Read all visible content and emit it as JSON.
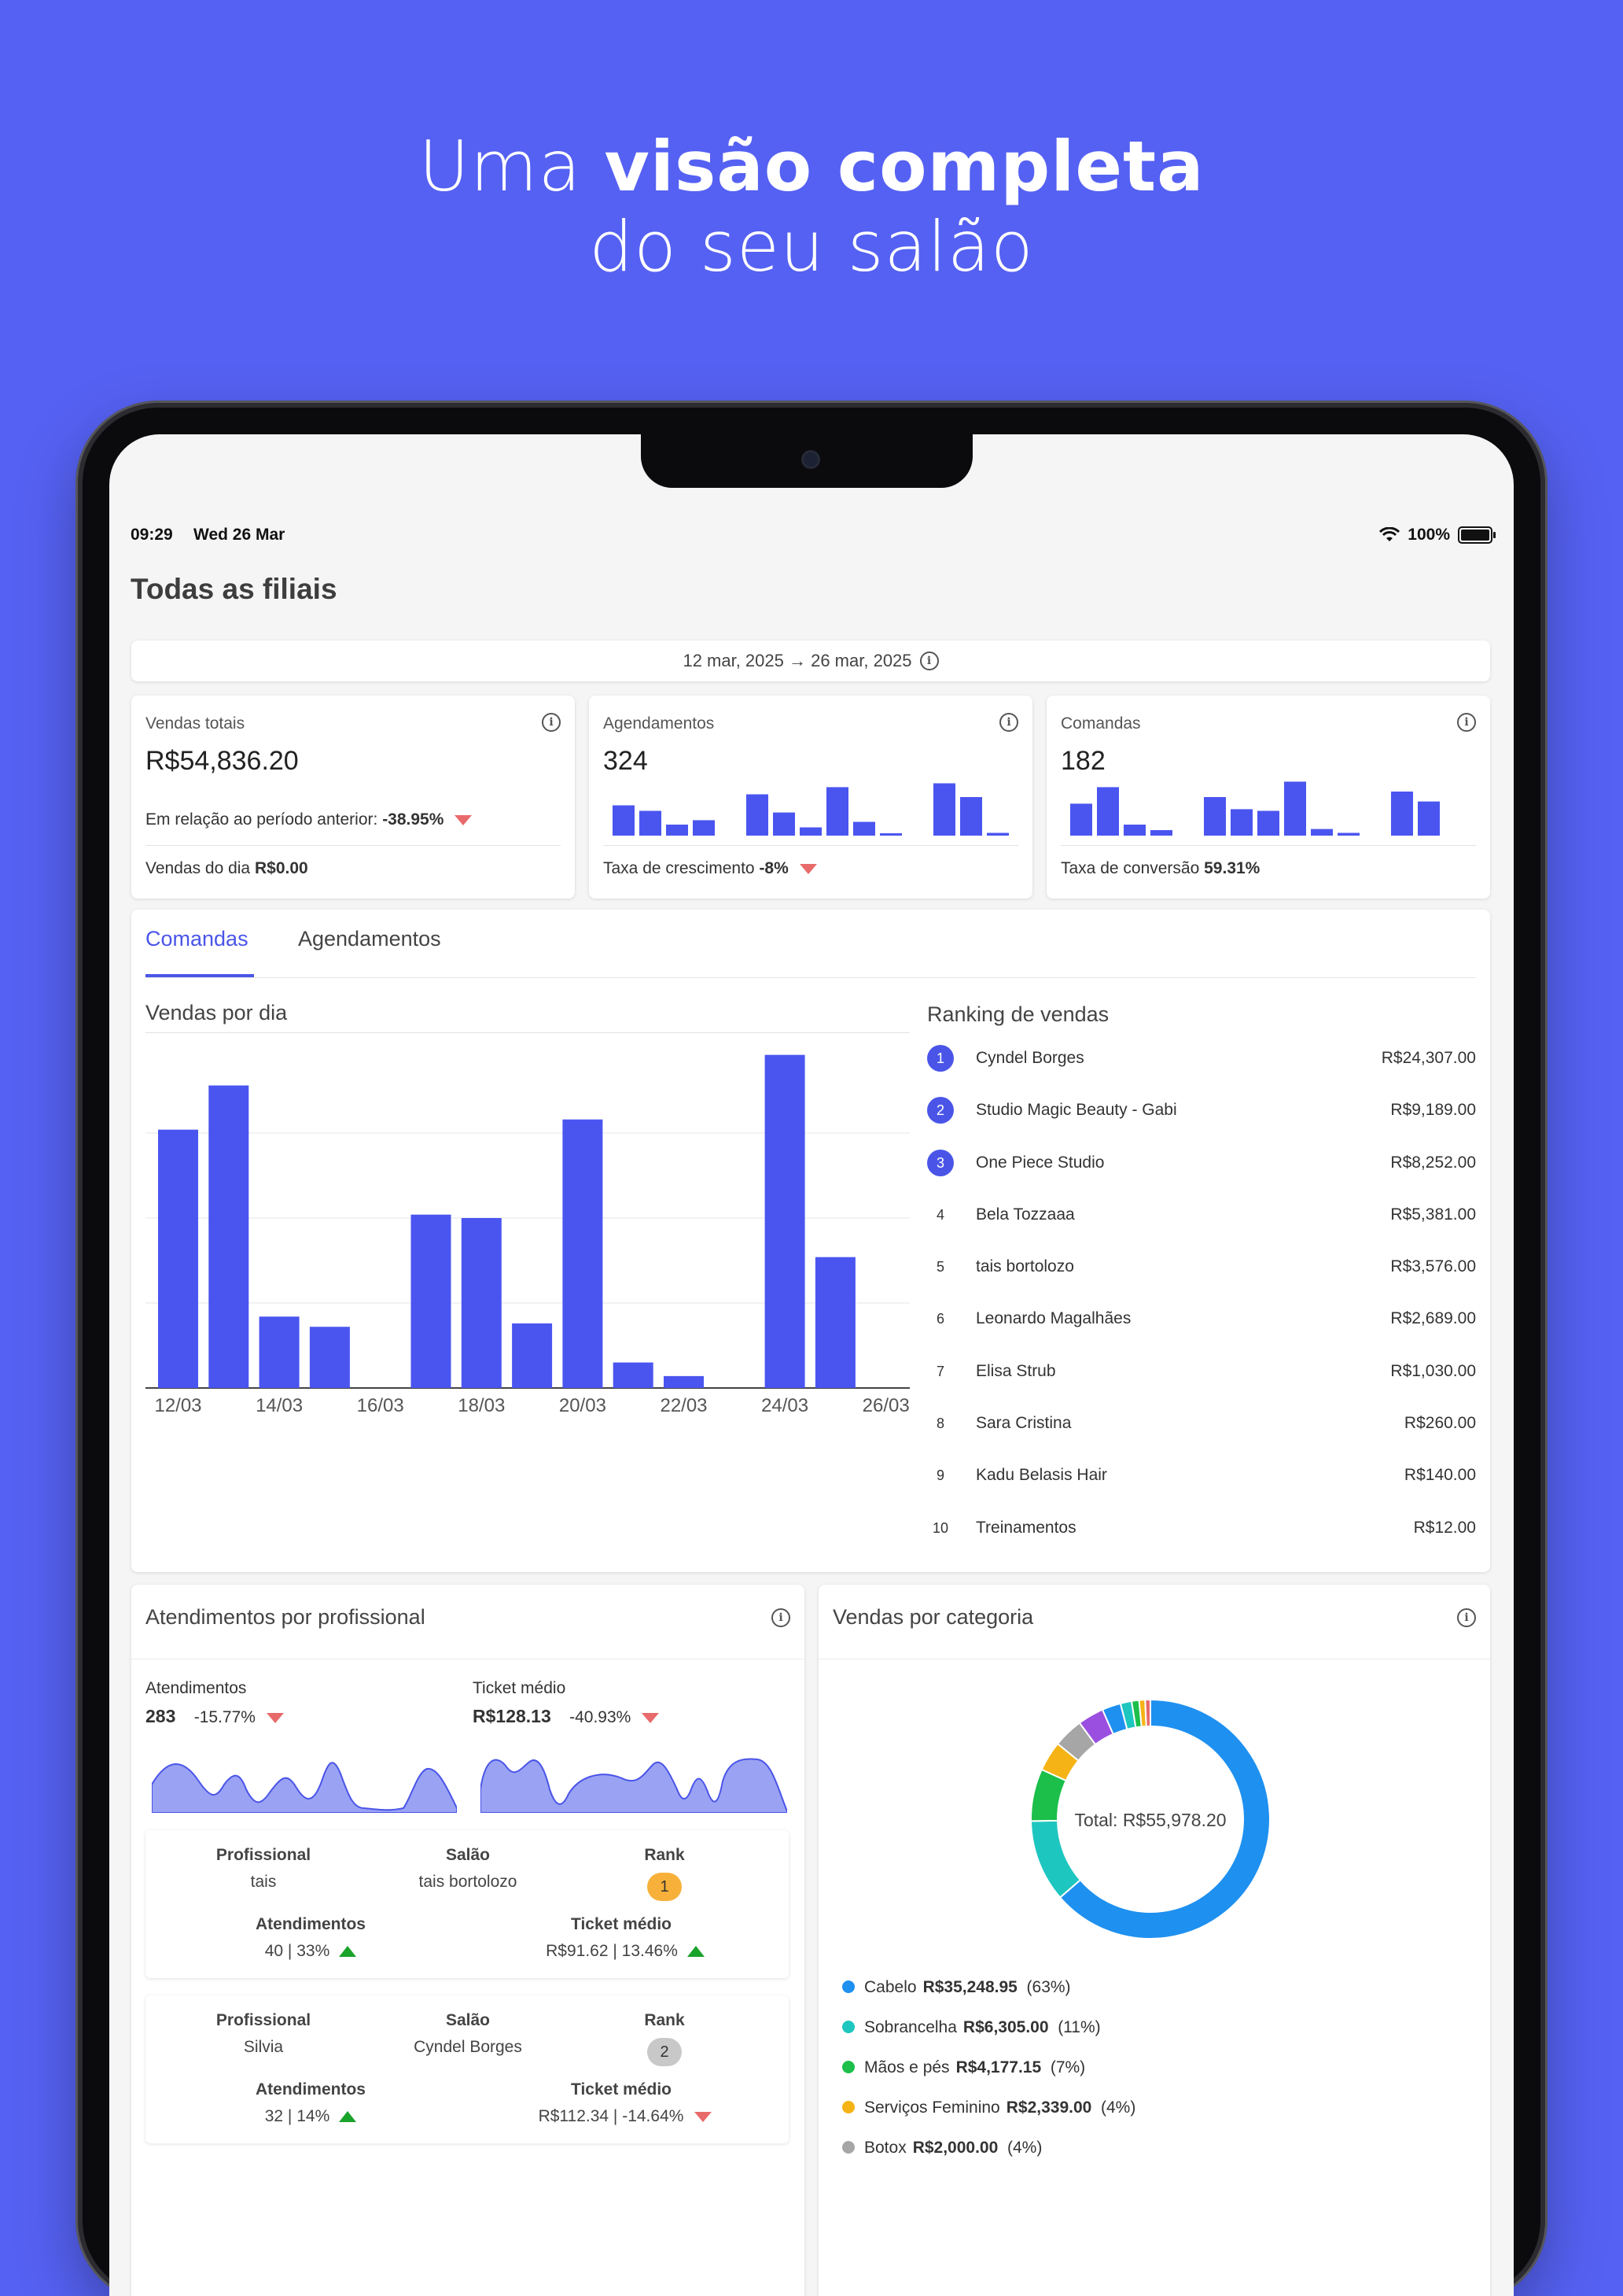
{
  "headline": {
    "line1_regular": "Uma ",
    "line1_bold": "visão completa",
    "line2": "do seu salão"
  },
  "status_bar": {
    "time": "09:29",
    "date": "Wed 26 Mar",
    "battery": "100%"
  },
  "page_title": "Todas as filiais",
  "date_range": "12 mar, 2025 → 26 mar, 2025",
  "kpis": {
    "vendas": {
      "label": "Vendas totais",
      "value": "R$54,836.20",
      "comparison_label": "Em relação ao período anterior:",
      "comparison_value": "-38.95%",
      "day_label": "Vendas do dia",
      "day_value": "R$0.00"
    },
    "agendamentos": {
      "label": "Agendamentos",
      "value": "324",
      "growth_label": "Taxa de crescimento",
      "growth_value": "-8%",
      "spark": [
        0.55,
        0.45,
        0.2,
        0.28,
        0,
        0.75,
        0.42,
        0.15,
        0.88,
        0.25,
        0.02,
        0,
        0.95,
        0.7,
        0.05
      ]
    },
    "comandas": {
      "label": "Comandas",
      "value": "182",
      "conversion_label": "Taxa de conversão",
      "conversion_value": "59.31%",
      "spark": [
        0.58,
        0.88,
        0.2,
        0.1,
        0,
        0.7,
        0.48,
        0.45,
        0.98,
        0.12,
        0.05,
        0,
        0.8,
        0.62,
        0
      ]
    }
  },
  "tabs": {
    "active": "Comandas",
    "other": "Agendamentos"
  },
  "chart_data": {
    "type": "bar",
    "title": "Vendas por dia",
    "categories": [
      "12/03",
      "13/03",
      "14/03",
      "15/03",
      "16/03",
      "17/03",
      "18/03",
      "19/03",
      "20/03",
      "21/03",
      "22/03",
      "23/03",
      "24/03",
      "25/03",
      "26/03"
    ],
    "values": [
      7600,
      8900,
      2100,
      1800,
      0,
      5100,
      5000,
      1900,
      7900,
      750,
      350,
      0,
      9800,
      3850,
      0
    ],
    "tick_labels": [
      "12/03",
      "14/03",
      "16/03",
      "18/03",
      "20/03",
      "22/03",
      "24/03",
      "26/03"
    ],
    "ylim": [
      0,
      10000
    ],
    "grid": true
  },
  "ranking": {
    "title": "Ranking de vendas",
    "items": [
      {
        "rank": "1",
        "name": "Cyndel Borges",
        "amount": "R$24,307.00"
      },
      {
        "rank": "2",
        "name": "Studio Magic Beauty - Gabi",
        "amount": "R$9,189.00"
      },
      {
        "rank": "3",
        "name": "One Piece Studio",
        "amount": "R$8,252.00"
      },
      {
        "rank": "4",
        "name": "Bela Tozzaaa",
        "amount": "R$5,381.00"
      },
      {
        "rank": "5",
        "name": "tais bortolozo",
        "amount": "R$3,576.00"
      },
      {
        "rank": "6",
        "name": "Leonardo Magalhães",
        "amount": "R$2,689.00"
      },
      {
        "rank": "7",
        "name": "Elisa Strub",
        "amount": "R$1,030.00"
      },
      {
        "rank": "8",
        "name": "Sara Cristina",
        "amount": "R$260.00"
      },
      {
        "rank": "9",
        "name": "Kadu Belasis Hair",
        "amount": "R$140.00"
      },
      {
        "rank": "10",
        "name": "Treinamentos",
        "amount": "R$12.00"
      }
    ]
  },
  "atendimentos": {
    "title": "Atendimentos por profissional",
    "metric1": {
      "label": "Atendimentos",
      "value": "283",
      "change": "-15.77%"
    },
    "metric2": {
      "label": "Ticket médio",
      "value": "R$128.13",
      "change": "-40.93%"
    },
    "headers": {
      "profissional": "Profissional",
      "salao": "Salão",
      "rank": "Rank",
      "atendimentos": "Atendimentos",
      "ticket": "Ticket médio"
    },
    "rows": [
      {
        "profissional": "tais",
        "salao": "tais bortolozo",
        "rank": "1",
        "atendimentos": "40 | 33%",
        "ticket": "R$91.62 | 13.46%"
      },
      {
        "profissional": "Silvia",
        "salao": "Cyndel Borges",
        "rank": "2",
        "atendimentos": "32 | 14%",
        "ticket": "R$112.34 | -14.64%"
      }
    ]
  },
  "categorias": {
    "title": "Vendas por categoria",
    "total": "Total: R$55,978.20",
    "items": [
      {
        "name": "Cabelo",
        "amount": "R$35,248.95",
        "pct": "(63%)",
        "color": "#1e90f0",
        "share": 0.63
      },
      {
        "name": "Sobrancelha",
        "amount": "R$6,305.00",
        "pct": "(11%)",
        "color": "#1ec6c0",
        "share": 0.11
      },
      {
        "name": "Mãos e pés",
        "amount": "R$4,177.15",
        "pct": "(7%)",
        "color": "#1bbf4a",
        "share": 0.07
      },
      {
        "name": "Serviços Feminino",
        "amount": "R$2,339.00",
        "pct": "(4%)",
        "color": "#f5b316",
        "share": 0.04
      },
      {
        "name": "Botox",
        "amount": "R$2,000.00",
        "pct": "(4%)",
        "color": "#a6a6a6",
        "share": 0.04
      }
    ],
    "other_shares": [
      {
        "color": "#9b4fe0",
        "share": 0.035
      },
      {
        "color": "#1e90f0",
        "share": 0.025
      },
      {
        "color": "#1ec6c0",
        "share": 0.015
      },
      {
        "color": "#1bbf4a",
        "share": 0.01
      },
      {
        "color": "#f5b316",
        "share": 0.008
      },
      {
        "color": "#e86a6a",
        "share": 0.007
      }
    ]
  }
}
